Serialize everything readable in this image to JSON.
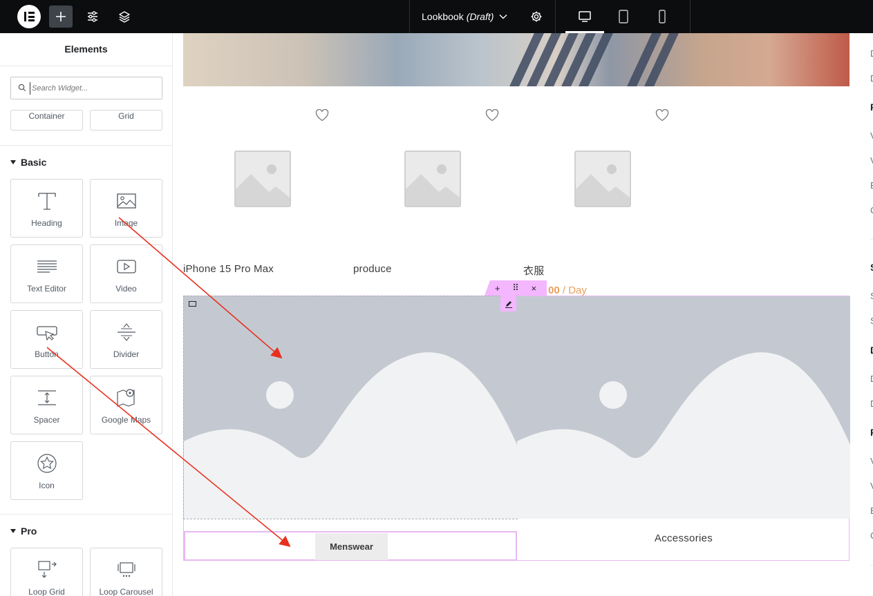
{
  "topbar": {
    "doc_title": "Lookbook",
    "doc_status": "(Draft)"
  },
  "panel": {
    "title": "Elements",
    "search_placeholder": "Search Widget...",
    "layout_items": [
      "Container",
      "Grid"
    ],
    "basic": {
      "title": "Basic",
      "items": [
        "Heading",
        "Image",
        "Text Editor",
        "Video",
        "Button",
        "Divider",
        "Spacer",
        "Google Maps",
        "Icon"
      ]
    },
    "pro": {
      "title": "Pro",
      "items": [
        "Loop Grid",
        "Loop Carousel"
      ]
    }
  },
  "canvas": {
    "products": [
      {
        "name": "iPhone 15 Pro Max"
      },
      {
        "name": "produce"
      },
      {
        "name": "衣服"
      }
    ],
    "price": {
      "amount": "00",
      "unit": "/ Day"
    },
    "section_tools": {
      "add": "+",
      "drag": "⠿",
      "close": "×"
    },
    "cards": {
      "left_button": "Menswear",
      "right_label": "Accessories"
    }
  },
  "right_panel": {
    "rows": [
      "D",
      "D",
      "F",
      "V",
      "V",
      "E",
      "C",
      "S",
      "S",
      "S",
      "D",
      "D",
      "D",
      "F",
      "V",
      "V",
      "E",
      "C"
    ]
  },
  "colors": {
    "topbar_bg": "#0c0d0e",
    "selection_pink": "#f3b6ff",
    "price_orange": "#e9a05c",
    "placeholder_gray": "#c4c9d1",
    "arrow_red": "#e8301f"
  }
}
